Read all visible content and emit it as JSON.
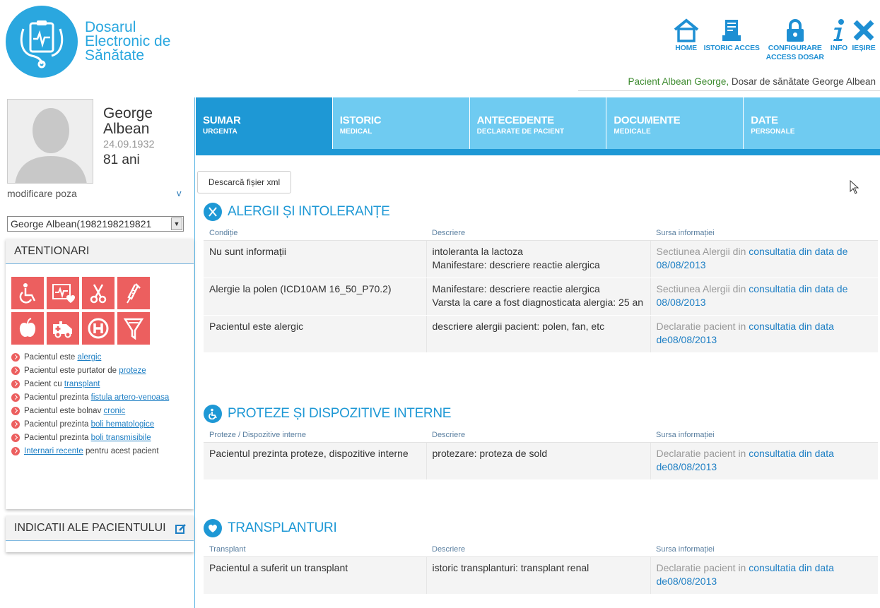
{
  "app": {
    "title_lines": [
      "Dosarul",
      "Electronic de",
      "Sănătate"
    ]
  },
  "topnav": [
    {
      "label": "HOME",
      "icon": "home-icon"
    },
    {
      "label": "ISTORIC ACCES",
      "icon": "history-icon"
    },
    {
      "label": "CONFIGURARE ACCESS DOSAR",
      "icon": "lock-icon"
    },
    {
      "label": "INFO",
      "icon": "info-icon"
    },
    {
      "label": "IEȘIRE",
      "icon": "close-icon"
    }
  ],
  "patient_line": {
    "prefix": "Pacient Albean George,",
    "suffix": " Dosar de sănătate George Albean"
  },
  "patient": {
    "first_name": "George",
    "last_name": "Albean",
    "dob": "24.09.1932",
    "age": "81 ani",
    "change_photo": "modificare poza",
    "toggle": "v",
    "selector_value": "George Albean(1982198219821"
  },
  "atentionari": {
    "title": "ATENTIONARI",
    "icons": [
      "wheelchair-icon",
      "heart-monitor-icon",
      "scissors-icon",
      "syringe-icon",
      "apple-icon",
      "ambulance-icon",
      "hospital-icon",
      "funnel-icon"
    ],
    "items": [
      {
        "pre": "Pacientul este ",
        "link": "alergic",
        "post": ""
      },
      {
        "pre": "Pacientul este purtator de ",
        "link": "proteze",
        "post": ""
      },
      {
        "pre": "Pacient cu ",
        "link": "transplant",
        "post": ""
      },
      {
        "pre": "Pacientul prezinta ",
        "link": "fistula artero-venoasa",
        "post": ""
      },
      {
        "pre": "Pacientul este bolnav ",
        "link": "cronic",
        "post": ""
      },
      {
        "pre": "Pacientul prezinta ",
        "link": "boli hematologice",
        "post": ""
      },
      {
        "pre": "Pacientul prezinta ",
        "link": "boli transmisibile",
        "post": ""
      },
      {
        "pre": "",
        "link": "Internari recente",
        "post": " pentru acest pacient"
      }
    ]
  },
  "indicatii": {
    "title": "INDICATII ALE PACIENTULUI",
    "icon": "edit-icon"
  },
  "tabs": [
    {
      "t1": "SUMAR",
      "t2": "URGENTA"
    },
    {
      "t1": "ISTORIC",
      "t2": "MEDICAL"
    },
    {
      "t1": "ANTECEDENTE",
      "t2": "DECLARATE DE PACIENT"
    },
    {
      "t1": "DOCUMENTE",
      "t2": "MEDICALE"
    },
    {
      "t1": "DATE",
      "t2": "PERSONALE"
    }
  ],
  "xml_button": "Descarcă fișier xml",
  "sections": [
    {
      "title": "ALERGII ȘI INTOLERANȚE",
      "icon": "dna-icon",
      "headers": [
        "Condiție",
        "Descriere",
        "Sursa informației"
      ],
      "rows": [
        {
          "c1": "Nu sunt informații",
          "c2": [
            "intoleranta la lactoza",
            "Manifestare: descriere reactie alergica"
          ],
          "src_pre": "Sectiunea Alergii din ",
          "src_link": "consultatia din data de",
          "src_post": "08/08/2013"
        },
        {
          "c1": "Alergie la polen (ICD10AM 16_50_P70.2)",
          "c2": [
            "Manifestare: descriere reactie alergica",
            "Varsta la care a fost diagnosticata alergia: 25 an"
          ],
          "src_pre": "Sectiunea Alergii din ",
          "src_link": "consultatia din data de",
          "src_post": "08/08/2013"
        },
        {
          "c1": "Pacientul este alergic",
          "c2": [
            "descriere alergii pacient: polen, fan, etc"
          ],
          "src_pre": "Declaratie pacient in ",
          "src_link": "consultatia din data",
          "src_post": "de08/08/2013"
        }
      ]
    },
    {
      "title": "PROTEZE ȘI DISPOZITIVE INTERNE",
      "icon": "wheelchair-icon",
      "headers": [
        "Proteze / Dispozitive interne",
        "Descriere",
        "Sursa informației"
      ],
      "rows": [
        {
          "c1": "Pacientul prezinta proteze, dispozitive interne",
          "c2": [
            "protezare: proteza de sold"
          ],
          "src_pre": "Declaratie pacient in ",
          "src_link": "consultatia din data",
          "src_post": "de08/08/2013"
        }
      ]
    },
    {
      "title": "TRANSPLANTURI",
      "icon": "heart-transplant-icon",
      "headers": [
        "Transplant",
        "Descriere",
        "Sursa informației"
      ],
      "rows": [
        {
          "c1": "Pacientul a suferit un transplant",
          "c2": [
            "istoric transplanturi: transplant renal"
          ],
          "src_pre": "Declaratie pacient in ",
          "src_link": "consultatia din data",
          "src_post": "de08/08/2013"
        }
      ]
    }
  ],
  "colors": {
    "primary": "#1e98d5",
    "tab_light": "#6fcbf1",
    "alert": "#ec5f5f",
    "patient_green": "#3d8b2f"
  }
}
